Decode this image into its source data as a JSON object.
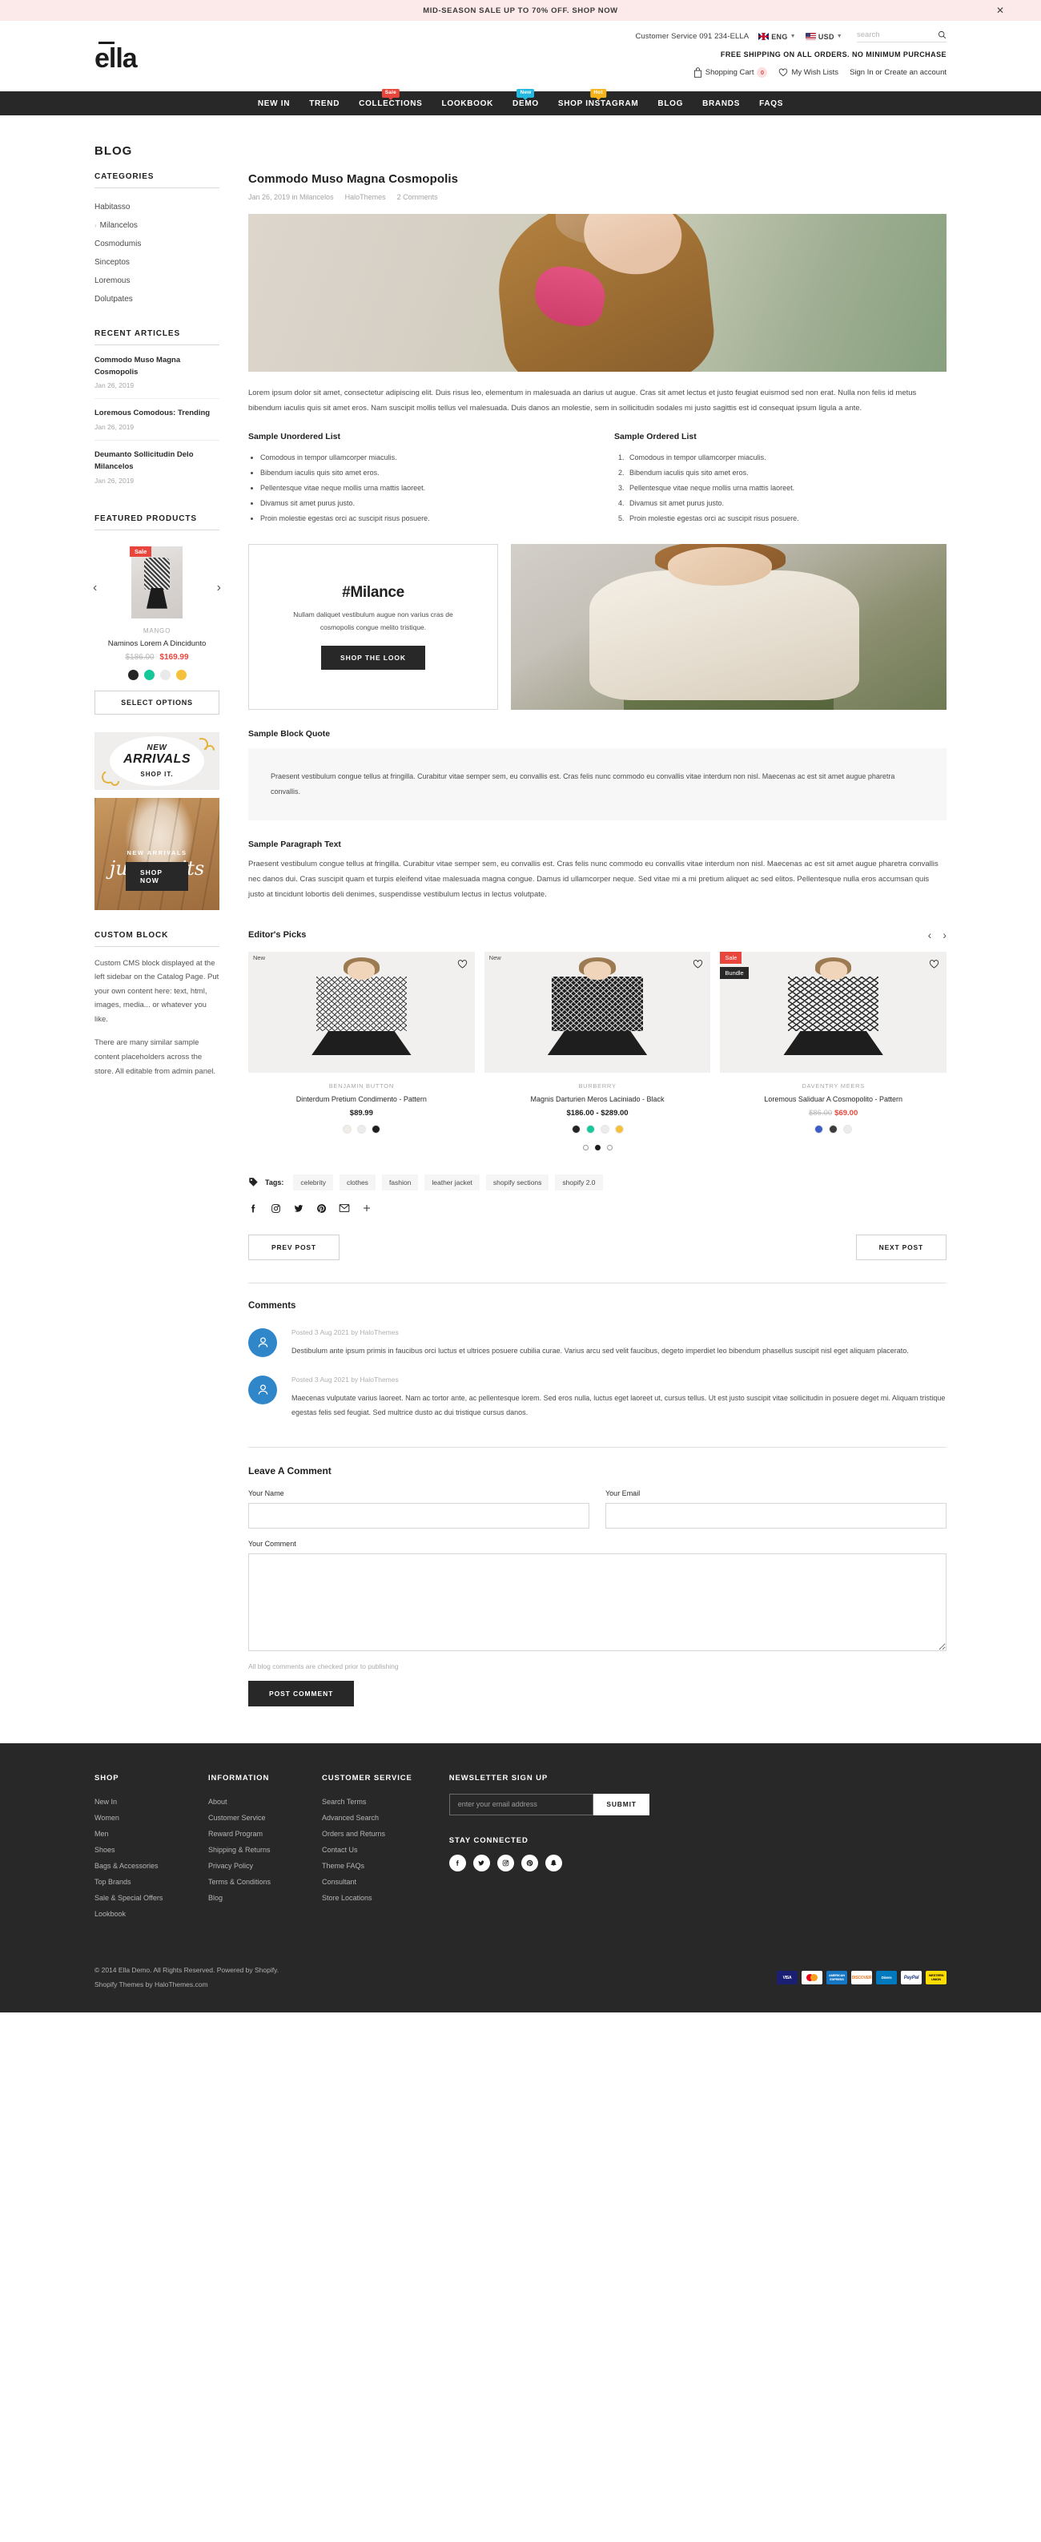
{
  "announcement": {
    "text": "MID-SEASON SALE UP TO 70% OFF. SHOP NOW",
    "close_icon": "close-icon"
  },
  "header": {
    "customer_service": "Customer Service 091 234-ELLA",
    "language": "ENG",
    "currency": "USD",
    "search_placeholder": "search",
    "logo": "ella",
    "free_shipping": "FREE SHIPPING ON ALL ORDERS. NO MINIMUM PURCHASE",
    "cart_label": "Shopping Cart",
    "cart_count": "0",
    "wishlist_label": "My Wish Lists",
    "account_label": "Sign In or Create an account"
  },
  "nav": [
    {
      "label": "NEW IN",
      "badge": null,
      "badge_type": null
    },
    {
      "label": "TREND",
      "badge": null,
      "badge_type": null
    },
    {
      "label": "COLLECTIONS",
      "badge": "Sale",
      "badge_type": "sale"
    },
    {
      "label": "LOOKBOOK",
      "badge": null,
      "badge_type": null
    },
    {
      "label": "DEMO",
      "badge": "New",
      "badge_type": "new"
    },
    {
      "label": "SHOP INSTAGRAM",
      "badge": "Hot",
      "badge_type": "hot"
    },
    {
      "label": "BLOG",
      "badge": null,
      "badge_type": null
    },
    {
      "label": "BRANDS",
      "badge": null,
      "badge_type": null
    },
    {
      "label": "FAQS",
      "badge": null,
      "badge_type": null
    }
  ],
  "page": {
    "title": "BLOG"
  },
  "sidebar": {
    "categories_heading": "CATEGORIES",
    "categories": [
      {
        "label": "Habitasso",
        "active": false
      },
      {
        "label": "Milancelos",
        "active": true
      },
      {
        "label": "Cosmodumis",
        "active": false
      },
      {
        "label": "Sinceptos",
        "active": false
      },
      {
        "label": "Loremous",
        "active": false
      },
      {
        "label": "Dolutpates",
        "active": false
      }
    ],
    "recent_heading": "RECENT ARTICLES",
    "recent": [
      {
        "title": "Commodo Muso Magna Cosmopolis",
        "date": "Jan 26, 2019"
      },
      {
        "title": "Loremous Comodous: Trending",
        "date": "Jan 26, 2019"
      },
      {
        "title": "Deumanto Sollicitudin Delo Milancelos",
        "date": "Jan 26, 2019"
      }
    ],
    "featured_heading": "FEATURED PRODUCTS",
    "featured_product": {
      "badge": "Sale",
      "brand": "MANGO",
      "name": "Naminos Lorem A Dincidunto",
      "old_price": "$186.00",
      "new_price": "$169.99",
      "swatches": [
        "#242424",
        "#16c79a",
        "#e9e9e9",
        "#f5c13b"
      ],
      "button": "SELECT OPTIONS"
    },
    "promo_new_arrivals": {
      "line1": "NEW",
      "line2": "ARRIVALS",
      "line3": "SHOP IT."
    },
    "promo_jumpsuits": {
      "label": "NEW ARRIVALS",
      "word": "jumpsuits",
      "button": "SHOP NOW"
    },
    "custom_block_heading": "CUSTOM BLOCK",
    "custom_block_p1": "Custom CMS block displayed at the left sidebar on the Catalog Page. Put your own content here: text, html, images, media... or whatever you like.",
    "custom_block_p2": "There are many similar sample content placeholders across the store. All editable from admin panel."
  },
  "article": {
    "title": "Commodo Muso Magna Cosmopolis",
    "meta_date": "Jan 26, 2019 in Milancelos",
    "meta_author": "HaloThemes",
    "meta_comments": "2 Comments",
    "paragraph": "Lorem ipsum dolor sit amet, consectetur adipiscing elit. Duis risus leo, elementum in malesuada an darius ut augue. Cras sit amet lectus et justo feugiat euismod sed non erat. Nulla non felis id metus bibendum iaculis quis sit amet eros. Nam suscipit mollis tellus vel malesuada. Duis danos an molestie, sem in sollicitudin sodales mi justo sagittis est id consequat ipsum ligula a ante.",
    "unordered_heading": "Sample Unordered List",
    "ordered_heading": "Sample Ordered List",
    "list_items": [
      "Comodous in tempor ullamcorper miaculis.",
      "Bibendum iaculis quis sito amet eros.",
      "Pellentesque vitae neque mollis urna mattis laoreet.",
      "Divamus sit amet purus justo.",
      "Proin molestie egestas orci ac suscipit risus posuere."
    ],
    "milance": {
      "heading": "#Milance",
      "text": "Nullam daliquet vestibulum augue non varius cras de cosmopolis congue melito tristique.",
      "button": "SHOP THE LOOK"
    },
    "blockquote_heading": "Sample Block Quote",
    "blockquote_text": "Praesent vestibulum congue tellus at fringilla. Curabitur vitae semper sem, eu convallis est. Cras felis nunc commodo eu convallis vitae interdum non nisl. Maecenas ac est sit amet augue pharetra convallis.",
    "paragraph_heading": "Sample Paragraph Text",
    "paragraph_text": "Praesent vestibulum congue tellus at fringilla. Curabitur vitae semper sem, eu convallis est. Cras felis nunc commodo eu convallis vitae interdum non nisl. Maecenas ac est sit amet augue pharetra convallis nec danos dui. Cras suscipit quam et turpis eleifend vitae malesuada magna congue. Damus id ullamcorper neque. Sed vitae mi a mi pretium aliquet ac sed elitos. Pellentesque nulla eros accumsan quis justo at tincidunt lobortis deli denimes, suspendisse vestibulum lectus in lectus volutpate."
  },
  "editors_picks": {
    "title": "Editor's Picks",
    "prev_icon": "chevron-left-icon",
    "next_icon": "chevron-right-icon",
    "products": [
      {
        "tags": [
          {
            "label": "New",
            "type": "new"
          }
        ],
        "brand": "BENJAMIN BUTTON",
        "name": "Dinterdum Pretium Condimento - Pattern",
        "price": "$89.99",
        "old_price": null,
        "swatches": [
          "#f0ece6",
          "#ececec",
          "#1f1f1f"
        ]
      },
      {
        "tags": [
          {
            "label": "New",
            "type": "new"
          }
        ],
        "brand": "BURBERRY",
        "name": "Magnis Darturien Meros Laciniado - Black",
        "price": "$186.00 - $289.00",
        "old_price": null,
        "swatches": [
          "#242424",
          "#16c79a",
          "#ececec",
          "#f5c13b"
        ]
      },
      {
        "tags": [
          {
            "label": "Sale",
            "type": "sale"
          },
          {
            "label": "Bundle",
            "type": "bundle"
          }
        ],
        "brand": "DAVENTRY MEERS",
        "name": "Loremous Saliduar A Cosmopolito - Pattern",
        "price": "$69.00",
        "old_price": "$86.00",
        "swatches": [
          "#3a5fc4",
          "#3c3c3c",
          "#ececec"
        ]
      }
    ],
    "dots": [
      false,
      true,
      false
    ]
  },
  "tags": {
    "label": "Tags:",
    "icon": "tag-icon",
    "items": [
      "celebrity",
      "clothes",
      "fashion",
      "leather jacket",
      "shopify sections",
      "shopify 2.0"
    ]
  },
  "share_icons": [
    "facebook-icon",
    "instagram-icon",
    "twitter-icon",
    "pinterest-icon",
    "email-icon",
    "plus-icon"
  ],
  "post_nav": {
    "prev": "PREV POST",
    "next": "NEXT POST"
  },
  "comments": {
    "title": "Comments",
    "items": [
      {
        "meta": "Posted 3 Aug 2021 by HaloThemes",
        "body": "Destibulum ante ipsum primis in faucibus orci luctus et ultrices posuere cubilia curae. Varius arcu sed velit faucibus, degeto imperdiet leo bibendum phasellus suscipit nisl eget aliquam placerato."
      },
      {
        "meta": "Posted 3 Aug 2021 by HaloThemes",
        "body": "Maecenas vulputate varius laoreet. Nam ac tortor ante, ac pellentesque lorem. Sed eros nulla, luctus eget laoreet ut, cursus tellus. Ut est justo suscipit vitae sollicitudin in posuere deget mi. Aliquam tristique egestas felis sed feugiat. Sed multrice dusto ac dui tristique cursus danos."
      }
    ]
  },
  "comment_form": {
    "title": "Leave A Comment",
    "name_label": "Your Name",
    "name_value": "",
    "email_label": "Your Email",
    "email_value": "",
    "comment_label": "Your Comment",
    "comment_value": "",
    "note": "All blog comments are checked prior to publishing",
    "submit": "POST COMMENT"
  },
  "footer": {
    "columns": [
      {
        "heading": "SHOP",
        "items": [
          "New In",
          "Women",
          "Men",
          "Shoes",
          "Bags & Accessories",
          "Top Brands",
          "Sale & Special Offers",
          "Lookbook"
        ]
      },
      {
        "heading": "INFORMATION",
        "items": [
          "About",
          "Customer Service",
          "Reward Program",
          "Shipping & Returns",
          "Privacy Policy",
          "Terms & Conditions",
          "Blog"
        ]
      },
      {
        "heading": "CUSTOMER SERVICE",
        "items": [
          "Search Terms",
          "Advanced Search",
          "Orders and Returns",
          "Contact Us",
          "Theme FAQs",
          "Consultant",
          "Store Locations"
        ]
      }
    ],
    "newsletter_heading": "NEWSLETTER SIGN UP",
    "newsletter_placeholder": "enter your email address",
    "newsletter_value": "",
    "newsletter_button": "SUBMIT",
    "stay_connected_heading": "STAY CONNECTED",
    "social_icons": [
      "facebook-icon",
      "twitter-icon",
      "instagram-icon",
      "pinterest-icon",
      "snapchat-icon"
    ],
    "copyright_line1": "© 2014 Ella Demo. All Rights Reserved. Powered by Shopify.",
    "copyright_line2": "Shopify Themes by HaloThemes.com",
    "payment_methods": [
      "VISA",
      "MasterCard",
      "AMERICAN EXPRESS",
      "DISCOVER",
      "Diners Club",
      "PayPal",
      "WESTERN UNION"
    ]
  }
}
